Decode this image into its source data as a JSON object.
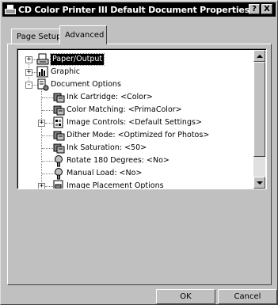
{
  "window": {
    "title": "CD Color Printer III Default Document Properties",
    "help_label": "?",
    "close_label": "X"
  },
  "tabs": [
    {
      "label": "Page Setup",
      "active": false
    },
    {
      "label": "Advanced",
      "active": true
    }
  ],
  "tree": {
    "items": [
      {
        "label": "Paper/Output",
        "icon": "paper-output-icon",
        "expander": "+",
        "selected": true
      },
      {
        "label": "Graphic",
        "icon": "graphic-icon",
        "expander": "+",
        "selected": false
      },
      {
        "label": "Document Options",
        "icon": "document-options-icon",
        "expander": "-",
        "selected": false
      },
      {
        "label": "Ink Cartridge: <Color>",
        "icon": "settings-icon",
        "expander": "",
        "selected": false
      },
      {
        "label": "Color Matching: <PrimaColor>",
        "icon": "settings-icon",
        "expander": "",
        "selected": false
      },
      {
        "label": "Image Controls: <Default Settings>",
        "icon": "image-controls-icon",
        "expander": "+",
        "selected": false
      },
      {
        "label": "Dither Mode: <Optimized for Photos>",
        "icon": "settings-icon",
        "expander": "",
        "selected": false
      },
      {
        "label": "Ink Saturation: <50>",
        "icon": "settings-icon",
        "expander": "",
        "selected": false
      },
      {
        "label": "Rotate 180 Degrees: <No>",
        "icon": "option-icon",
        "expander": "",
        "selected": false
      },
      {
        "label": "Manual Load: <No>",
        "icon": "option-icon",
        "expander": "",
        "selected": false
      },
      {
        "label": "Image Placement Options",
        "icon": "image-placement-icon",
        "expander": "+",
        "selected": false
      }
    ]
  },
  "buttons": {
    "ok_label": "OK",
    "cancel_label": "Cancel"
  }
}
